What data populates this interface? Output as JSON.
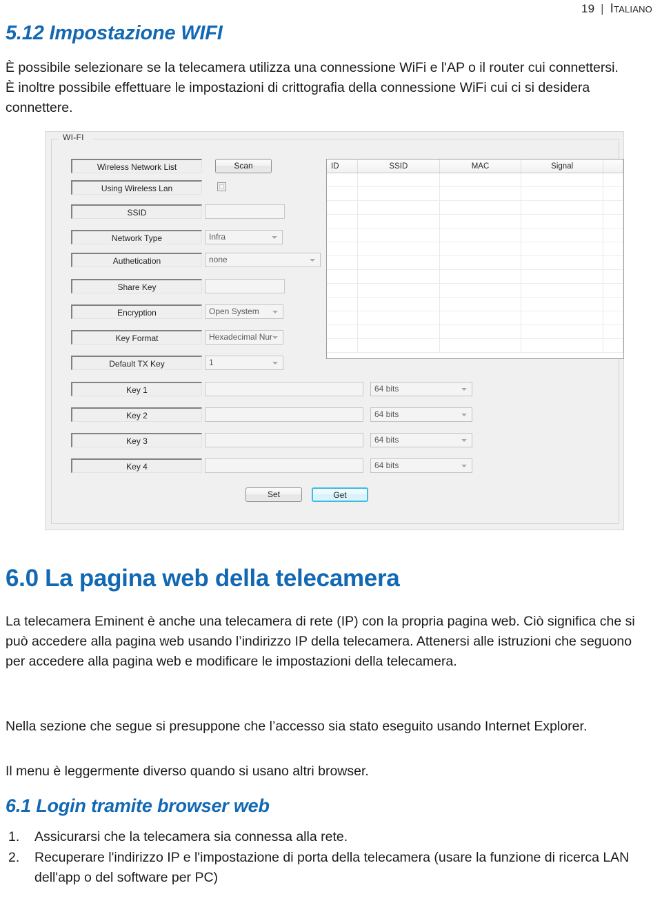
{
  "page_header": {
    "number": "19",
    "separator": "|",
    "language": "Italiano"
  },
  "section_512": {
    "heading": "5.12 Impostazione WIFI",
    "paragraph": "È possibile selezionare se la telecamera utilizza una connessione WiFi e l'AP o il router cui connettersi. È inoltre possibile effettuare le impostazioni di crittografia della connessione WiFi cui ci si desidera connettere."
  },
  "wifi_dialog": {
    "group_title": "WI-FI",
    "labels": {
      "wireless_network_list": "Wireless Network List",
      "using_wireless_lan": "Using Wireless Lan",
      "ssid": "SSID",
      "network_type": "Network Type",
      "authetication": "Authetication",
      "share_key": "Share Key",
      "encryption": "Encryption",
      "key_format": "Key Format",
      "default_tx_key": "Default TX Key",
      "key1": "Key 1",
      "key2": "Key 2",
      "key3": "Key 3",
      "key4": "Key 4"
    },
    "buttons": {
      "scan": "Scan",
      "set": "Set",
      "get": "Get"
    },
    "values": {
      "using_wireless_lan_checked": false,
      "ssid": "",
      "network_type": "Infra",
      "authetication": "none",
      "share_key": "",
      "encryption": "Open System",
      "key_format": "Hexadecimal Nur",
      "default_tx_key": "1",
      "key1": "",
      "key2": "",
      "key3": "",
      "key4": "",
      "key1_bits": "64 bits",
      "key2_bits": "64 bits",
      "key3_bits": "64 bits",
      "key4_bits": "64 bits"
    },
    "network_table": {
      "columns": [
        "ID",
        "SSID",
        "MAC",
        "Signal",
        ""
      ],
      "rows": [],
      "empty_row_count": 13
    },
    "colors": {
      "focus_border": "#3fbbe0",
      "panel_background": "#f0f0f0"
    }
  },
  "section_60": {
    "heading": "6.0 La pagina web della telecamera",
    "paragraph_1": "La telecamera Eminent è anche una telecamera di rete (IP) con la propria pagina web. Ciò significa che si può accedere alla pagina web usando l’indirizzo IP della telecamera. Attenersi alle istruzioni che seguono per accedere alla pagina web e modificare le impostazioni della telecamera.",
    "paragraph_2": "Nella sezione che segue si presuppone che l’accesso sia stato eseguito usando Internet Explorer.",
    "paragraph_3": "Il menu è leggermente diverso quando si usano altri browser."
  },
  "section_61": {
    "heading": "6.1 Login tramite browser web",
    "steps": [
      {
        "num": "1.",
        "text": "Assicurarsi che la telecamera sia connessa alla rete."
      },
      {
        "num": "2.",
        "text": "Recuperare l'indirizzo IP e l'impostazione di porta della telecamera (usare la funzione di ricerca LAN dell'app o del software per PC)"
      }
    ]
  },
  "theme": {
    "heading_blue": "#1268b3",
    "body_text": "#1a1a1a"
  }
}
